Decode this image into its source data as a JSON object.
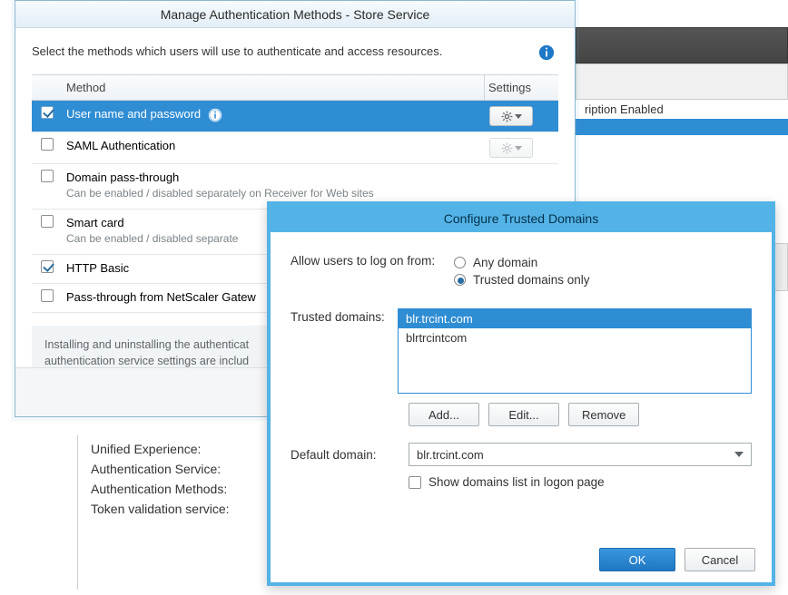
{
  "bg": {
    "enabled_label": "ription Enabled",
    "labels": [
      "Unified Experience:",
      "Authentication Service:",
      "Authentication Methods:",
      "",
      "Token validation service:"
    ]
  },
  "win1": {
    "title": "Manage Authentication Methods - Store Service",
    "intro": "Select the methods which users will use to authenticate and access resources.",
    "col_method": "Method",
    "col_settings": "Settings",
    "rows": {
      "r0": {
        "label": "User name and password"
      },
      "r1": {
        "label": "SAML Authentication"
      },
      "r2": {
        "label": "Domain pass-through",
        "sub": "Can be enabled / disabled separately on Receiver for Web sites"
      },
      "r3": {
        "label": "Smart card",
        "sub": "Can be enabled / disabled separate"
      },
      "r4": {
        "label": "HTTP Basic"
      },
      "r5": {
        "label": "Pass-through from NetScaler Gatew"
      }
    },
    "note": "Installing and uninstalling the authenticat\nauthentication service settings are includ"
  },
  "win2": {
    "title": "Configure Trusted Domains",
    "allow_label": "Allow users to log on from:",
    "opt_any": "Any domain",
    "opt_trusted": "Trusted domains only",
    "trusted_label": "Trusted domains:",
    "items": {
      "i0": "blr.trcint.com",
      "i1": "blrtrcintcom"
    },
    "btn_add": "Add...",
    "btn_edit": "Edit...",
    "btn_remove": "Remove",
    "default_label": "Default domain:",
    "default_value": "blr.trcint.com",
    "show_label": "Show domains list in logon page",
    "ok": "OK",
    "cancel": "Cancel"
  }
}
